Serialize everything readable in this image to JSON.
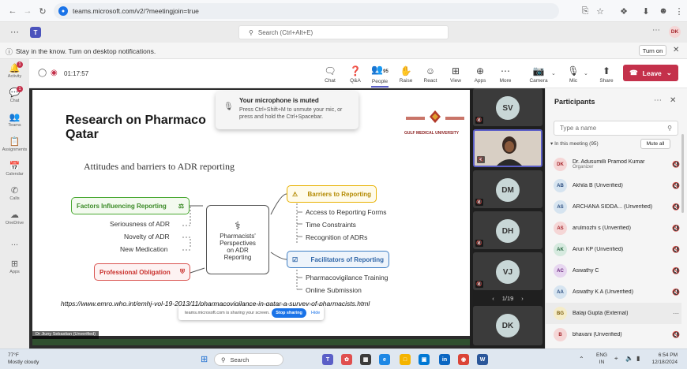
{
  "browser": {
    "url": "teams.microsoft.com/v2/?meetingjoin=true"
  },
  "teams": {
    "search_placeholder": "Search (Ctrl+Alt+E)",
    "user_initials": "DK",
    "notification_text": "Stay in the know. Turn on desktop notifications.",
    "turn_on_label": "Turn on"
  },
  "left_rail": [
    {
      "label": "Activity",
      "icon": "bell-icon",
      "badge": "1"
    },
    {
      "label": "Chat",
      "icon": "chat-icon",
      "badge": "1"
    },
    {
      "label": "Teams",
      "icon": "teams-icon",
      "badge": ""
    },
    {
      "label": "Assignments",
      "icon": "assignments-icon",
      "badge": ""
    },
    {
      "label": "Calendar",
      "icon": "calendar-icon",
      "badge": ""
    },
    {
      "label": "Calls",
      "icon": "phone-icon",
      "badge": ""
    },
    {
      "label": "OneDrive",
      "icon": "cloud-icon",
      "badge": ""
    },
    {
      "label": "...",
      "icon": "more-icon",
      "badge": ""
    },
    {
      "label": "Apps",
      "icon": "apps-icon",
      "badge": ""
    }
  ],
  "meeting": {
    "timer": "01:17:57",
    "people_count": "95",
    "toolbar": {
      "chat": "Chat",
      "qa": "Q&A",
      "people": "People",
      "raise": "Raise",
      "react": "React",
      "view": "View",
      "apps": "Apps",
      "more": "More",
      "camera": "Camera",
      "mic": "Mic",
      "share": "Share",
      "leave": "Leave"
    },
    "mute_toast": {
      "title": "Your microphone is muted",
      "body": "Press Ctrl+Shift+M to unmute your mic, or press and hold the Ctrl+Spacebar."
    },
    "share_bar": {
      "text": "teams.microsoft.com is sharing your screen.",
      "stop": "Stop sharing",
      "hide": "Hide"
    },
    "presenter_label": "Dr Jiuny Sebastian (Unverified)",
    "tiles": [
      {
        "initials": "SV",
        "type": "initials"
      },
      {
        "initials": "",
        "type": "video"
      },
      {
        "initials": "DM",
        "type": "initials"
      },
      {
        "initials": "DH",
        "type": "initials"
      },
      {
        "initials": "VJ",
        "type": "initials"
      },
      {
        "initials": "DK",
        "type": "initials"
      }
    ],
    "pager": "1/19"
  },
  "slide": {
    "title_line1": "Research on Pharmaco",
    "title_line2": "Qatar",
    "subtitle": "Attitudes and barriers to ADR reporting",
    "logo_text": "GULF MEDICAL UNIVERSITY",
    "center": [
      "Pharmacists'",
      "Perspectives",
      "on ADR",
      "Reporting"
    ],
    "factors": {
      "label": "Factors Influencing Reporting",
      "items": [
        "Seriousness of ADR",
        "Novelty of ADR",
        "New Medication"
      ]
    },
    "professional": "Professional Obligation",
    "barriers": {
      "label": "Barriers to Reporting",
      "items": [
        "Access to Reporting Forms",
        "Time Constraints",
        "Recognition of ADRs"
      ]
    },
    "facilitators": {
      "label": "Facilitators of Reporting",
      "items": [
        "Pharmacovigilance Training",
        "Online Submission"
      ]
    },
    "url": "https://www.emro.who.int/emhj-vol-19-2013/11/pharmacovigilance-in-qatar-a-survey-of-pharmacists.html"
  },
  "participants": {
    "title": "Participants",
    "search_placeholder": "Type a name",
    "in_meeting": "In this meeting (95)",
    "mute_all": "Mute all",
    "list": [
      {
        "initials": "DK",
        "name": "Dr. Adusumilli Pramod Kumar",
        "sub": "Organizer",
        "bg": "#f5d6d6",
        "fg": "#a4262c",
        "action": "mic-off"
      },
      {
        "initials": "AB",
        "name": "Akhila B (Unverified)",
        "sub": "",
        "bg": "#d6e4f0",
        "fg": "#2b4c7e",
        "action": "mic-off"
      },
      {
        "initials": "AS",
        "name": "ARCHANA SIDDA... (Unverified)",
        "sub": "",
        "bg": "#d6e4f0",
        "fg": "#2b4c7e",
        "action": "mic-off"
      },
      {
        "initials": "AS",
        "name": "arulmozhi s (Unverified)",
        "sub": "",
        "bg": "#f5d6d6",
        "fg": "#a4262c",
        "action": "mic-off"
      },
      {
        "initials": "AK",
        "name": "Arun KP (Unverified)",
        "sub": "",
        "bg": "#d6eadf",
        "fg": "#2b6a45",
        "action": "mic-off"
      },
      {
        "initials": "AC",
        "name": "Aswathy C",
        "sub": "",
        "bg": "#e7d6f0",
        "fg": "#6b2b7e",
        "action": "mic-off"
      },
      {
        "initials": "AA",
        "name": "Aswathy K A (Unverified)",
        "sub": "",
        "bg": "#d6e4f0",
        "fg": "#2b4c7e",
        "action": "mic-off"
      },
      {
        "initials": "BG",
        "name": "Balaji Gupta (External)",
        "sub": "",
        "bg": "#f5ecc8",
        "fg": "#7a5b0b",
        "action": "more"
      },
      {
        "initials": "B",
        "name": "bhavani (Unverified)",
        "sub": "",
        "bg": "#f5d6d6",
        "fg": "#a4262c",
        "action": "mic-off"
      }
    ]
  },
  "taskbar": {
    "weather_temp": "77°F",
    "weather_desc": "Mostly cloudy",
    "search": "Search",
    "lang1": "ENG",
    "lang2": "IN",
    "time": "6:54 PM",
    "date": "12/18/2024"
  },
  "colors": {
    "accent": "#5b5fc7",
    "leave": "#c4314b",
    "factors_green": "#4aa832",
    "barriers_yellow": "#e8b100",
    "facilitators_blue": "#3f7fc4",
    "professional_red": "#d9534f"
  }
}
